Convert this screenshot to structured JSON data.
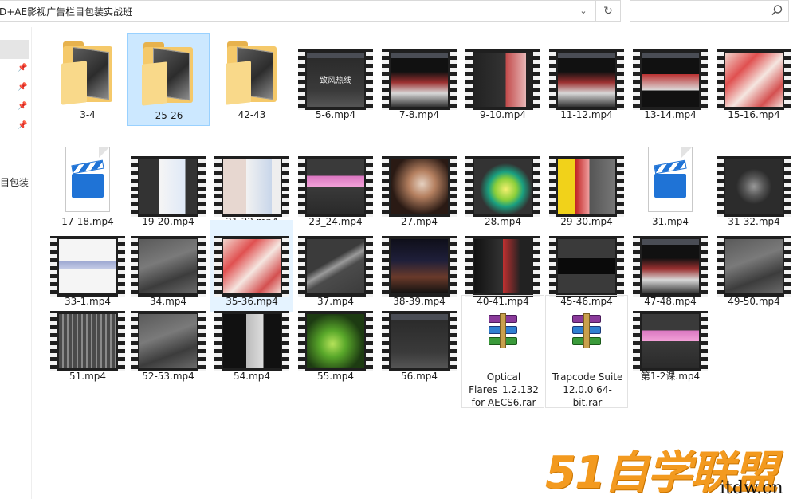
{
  "address_bar": {
    "path": "D+AE影视广告栏目包装实战班"
  },
  "nav_pane": {
    "partial_label": "目包装"
  },
  "icons": {
    "dropdown": "chevron-down-icon",
    "refresh": "refresh-icon",
    "search": "search-icon",
    "pin": "pin-icon"
  },
  "colors": {
    "selected_bg": "#cce8ff",
    "hover_bg": "#e5f3ff",
    "watermark": "#f39a1f"
  },
  "items": [
    {
      "name": "3-4",
      "type": "folder"
    },
    {
      "name": "25-26",
      "type": "folder",
      "state": "selected"
    },
    {
      "name": "42-43",
      "type": "folder"
    },
    {
      "name": "5-6.mp4",
      "type": "video",
      "preview": "dark-ui",
      "overlay": "致风热线"
    },
    {
      "name": "7-8.mp4",
      "type": "video",
      "preview": "red-3d"
    },
    {
      "name": "9-10.mp4",
      "type": "video",
      "preview": "dark-panel-red"
    },
    {
      "name": "11-12.mp4",
      "type": "video",
      "preview": "red-3d"
    },
    {
      "name": "13-14.mp4",
      "type": "video",
      "preview": "red-split"
    },
    {
      "name": "15-16.mp4",
      "type": "video",
      "preview": "pink-photo"
    },
    {
      "name": "17-18.mp4",
      "type": "media-file"
    },
    {
      "name": "19-20.mp4",
      "type": "video",
      "preview": "window-dialog"
    },
    {
      "name": "21-22.mp4",
      "type": "video",
      "preview": "window-photo"
    },
    {
      "name": "23_24.mp4",
      "type": "video",
      "preview": "dark-ui-pink"
    },
    {
      "name": "27.mp4",
      "type": "video",
      "preview": "brown-photo"
    },
    {
      "name": "28.mp4",
      "type": "video",
      "preview": "green-ball"
    },
    {
      "name": "29-30.mp4",
      "type": "video",
      "preview": "yellow-red"
    },
    {
      "name": "31.mp4",
      "type": "media-file"
    },
    {
      "name": "31-32.mp4",
      "type": "video",
      "preview": "dark-sphere"
    },
    {
      "name": "33-1.mp4",
      "type": "video",
      "preview": "white-panel"
    },
    {
      "name": "34.mp4",
      "type": "video",
      "preview": "gray-3d"
    },
    {
      "name": "35-36.mp4",
      "type": "video",
      "preview": "pink-photo",
      "state": "hovered"
    },
    {
      "name": "37.mp4",
      "type": "video",
      "preview": "gray-curve"
    },
    {
      "name": "38-39.mp4",
      "type": "video",
      "preview": "night-city"
    },
    {
      "name": "40-41.mp4",
      "type": "video",
      "preview": "dark-red"
    },
    {
      "name": "45-46.mp4",
      "type": "video",
      "preview": "dark-title"
    },
    {
      "name": "47-48.mp4",
      "type": "video",
      "preview": "red-3d"
    },
    {
      "name": "49-50.mp4",
      "type": "video",
      "preview": "gray-3d"
    },
    {
      "name": "51.mp4",
      "type": "video",
      "preview": "gray-bars"
    },
    {
      "name": "52-53.mp4",
      "type": "video",
      "preview": "gray-3d"
    },
    {
      "name": "54.mp4",
      "type": "video",
      "preview": "dark-panel"
    },
    {
      "name": "55.mp4",
      "type": "video",
      "preview": "green-sprout"
    },
    {
      "name": "56.mp4",
      "type": "video",
      "preview": "dark-ui"
    },
    {
      "name": "Optical Flares_1.2.132 for AECS6.rar",
      "type": "archive"
    },
    {
      "name": "Trapcode Suite 12.0.0 64-bit.rar",
      "type": "archive"
    },
    {
      "name": "第1-2课.mp4",
      "type": "video",
      "preview": "dark-ui-pink"
    }
  ],
  "watermark": {
    "logo": "51自学联盟",
    "url": "itdw.cn"
  }
}
